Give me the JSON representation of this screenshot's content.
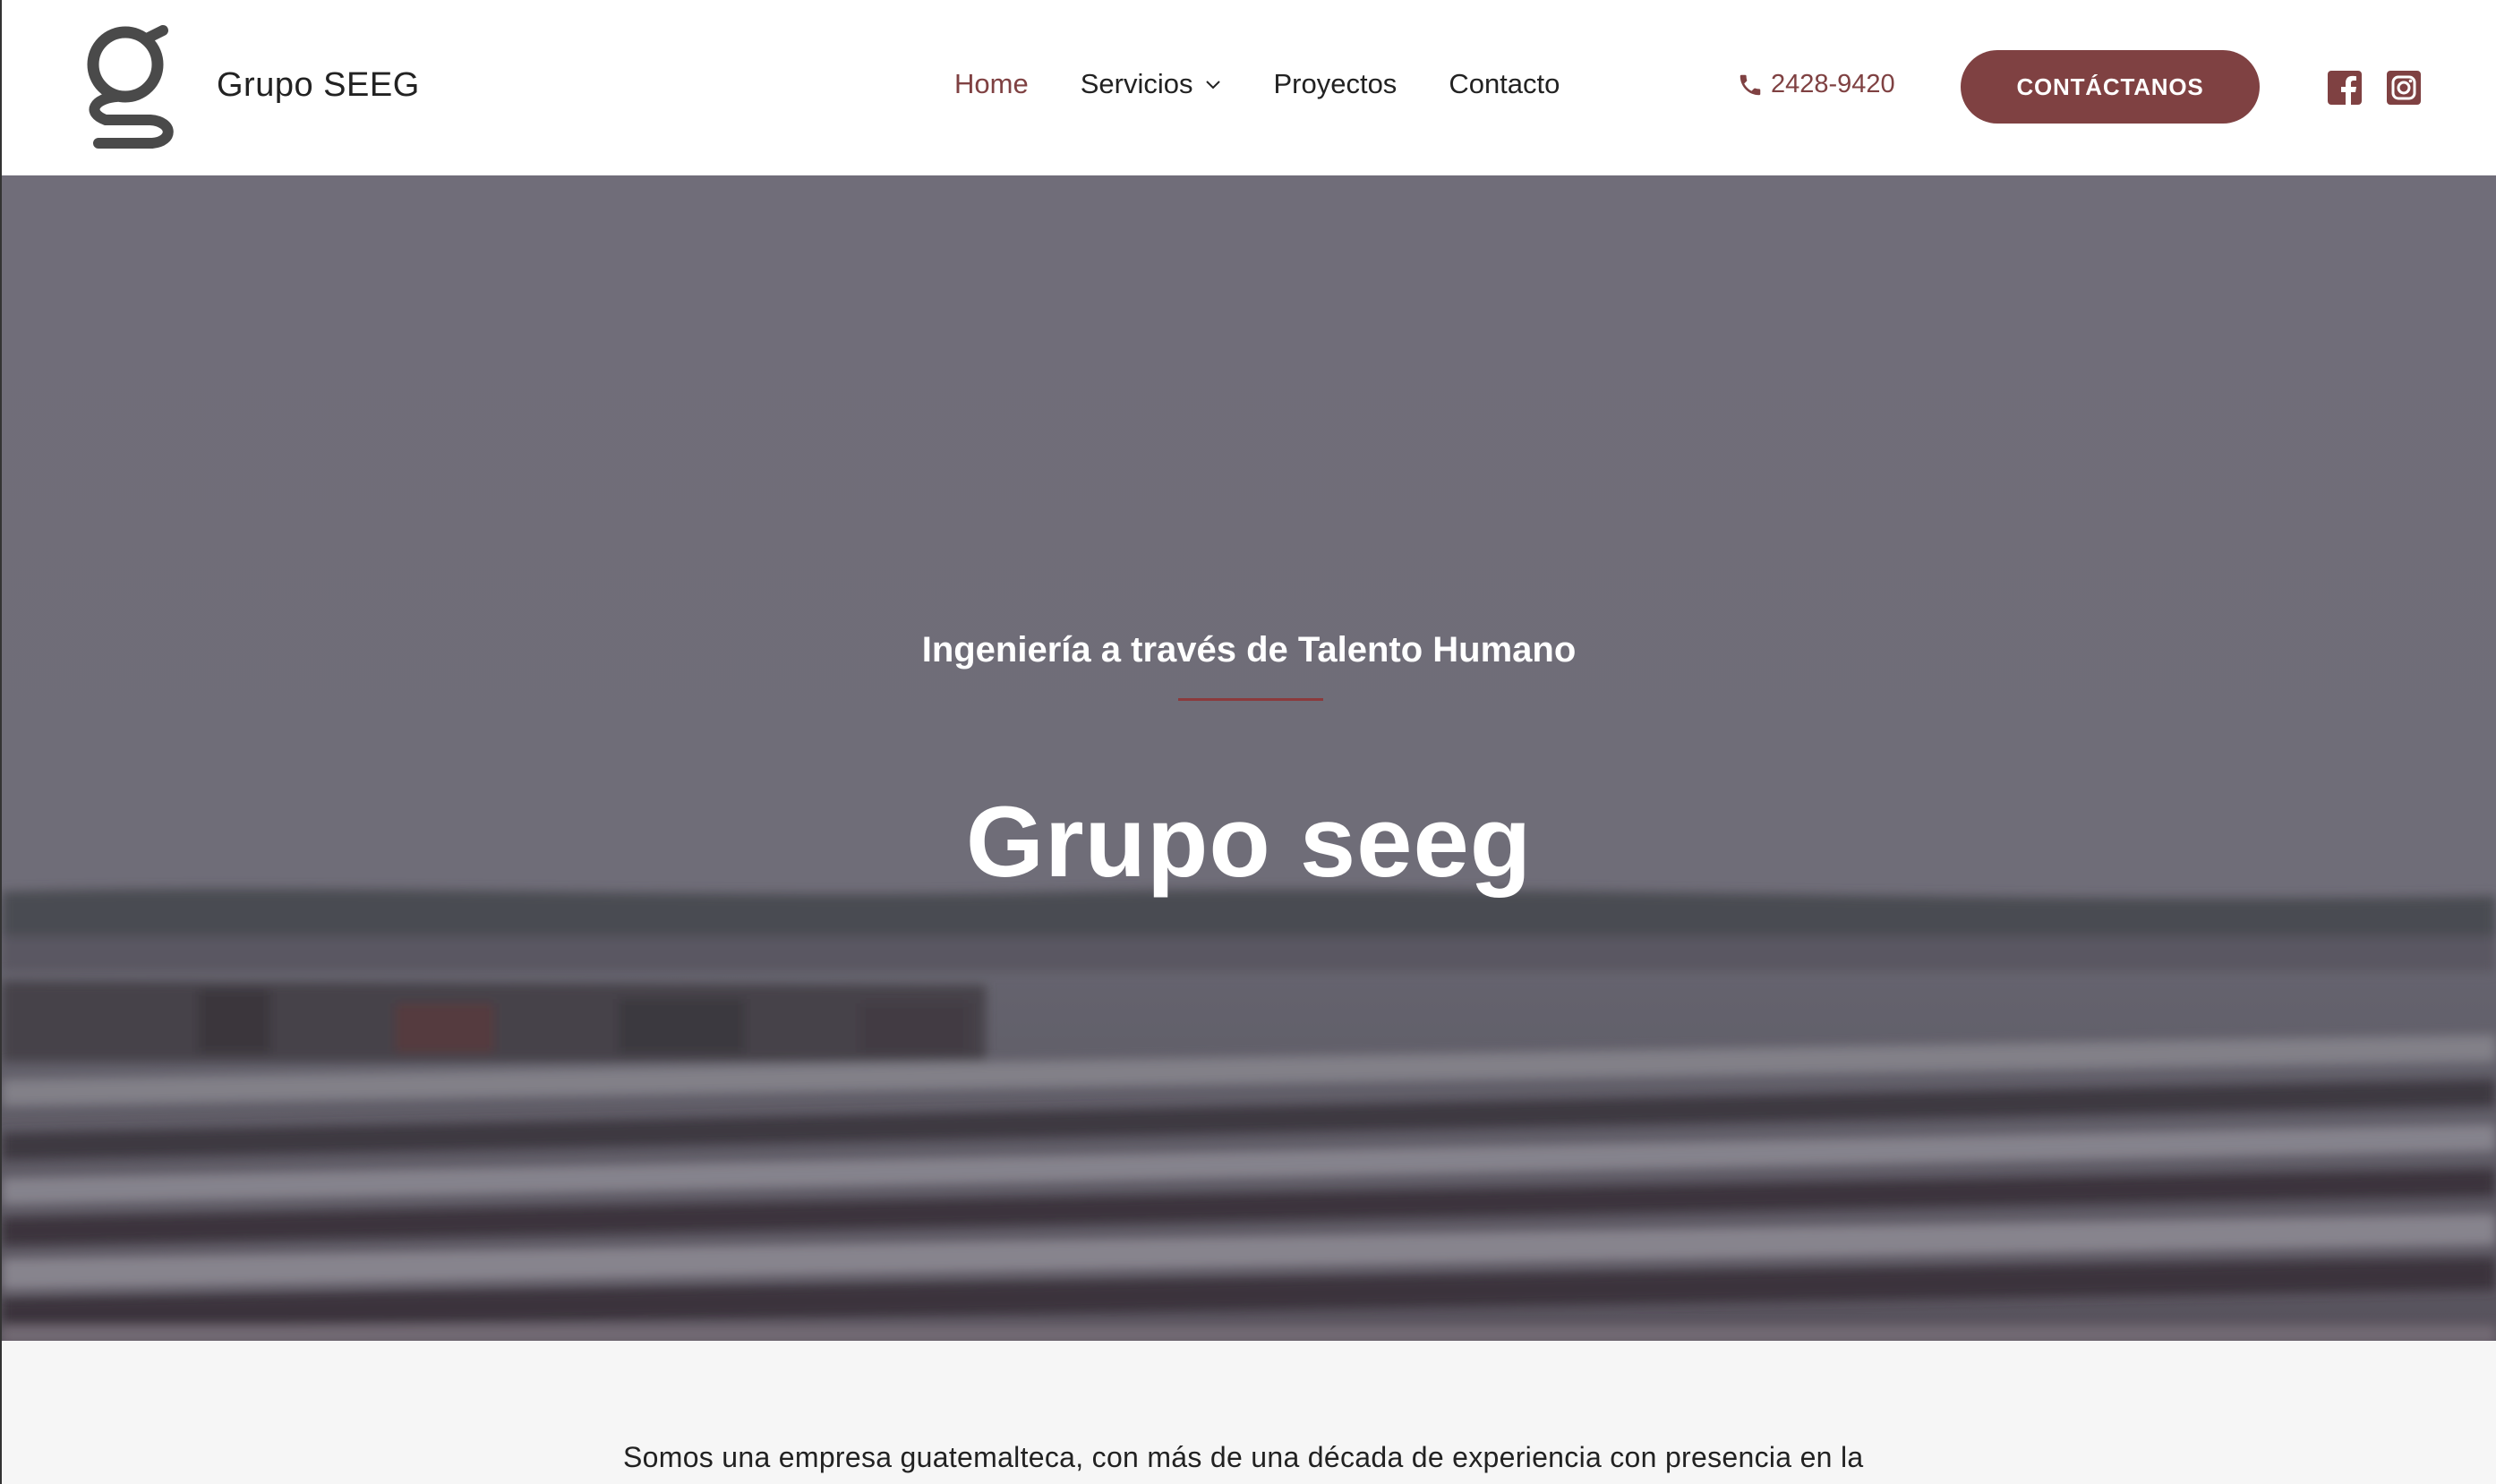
{
  "header": {
    "brand": "Grupo SEEG",
    "nav": [
      {
        "label": "Home",
        "active": true
      },
      {
        "label": "Servicios",
        "has_dropdown": true
      },
      {
        "label": "Proyectos"
      },
      {
        "label": "Contacto"
      }
    ],
    "phone": "2428-9420",
    "cta_label": "CONTÁCTANOS",
    "social_icons": [
      "facebook-icon",
      "instagram-icon"
    ]
  },
  "hero": {
    "subtitle": "Ingeniería a través de Talento Humano",
    "title": "Grupo seeg"
  },
  "content": {
    "intro": "Somos una empresa guatemalteca, con más de una década de experiencia con presencia en la"
  },
  "colors": {
    "accent": "#7f4142",
    "background": "#f6f6f6"
  }
}
